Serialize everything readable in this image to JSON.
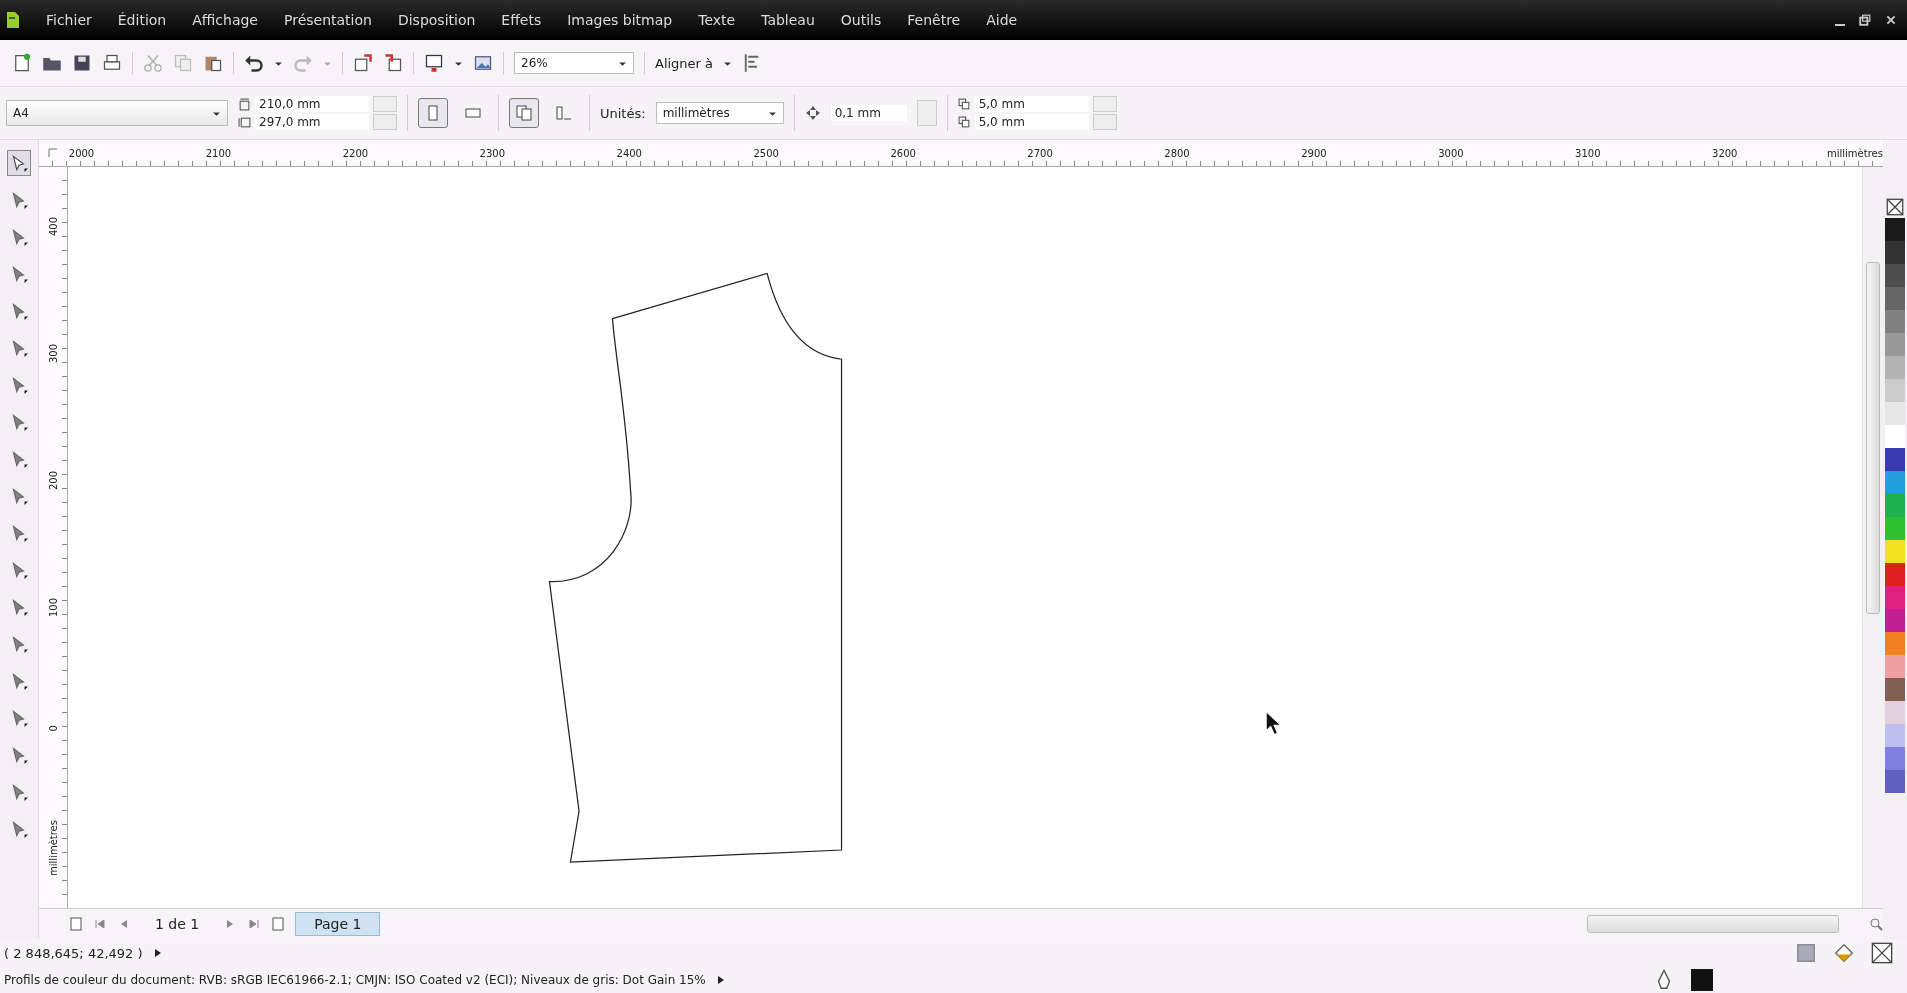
{
  "menu": [
    "Fichier",
    "Édition",
    "Affichage",
    "Présentation",
    "Disposition",
    "Effets",
    "Images bitmap",
    "Texte",
    "Tableau",
    "Outils",
    "Fenêtre",
    "Aide"
  ],
  "toolbar": {
    "zoom": "26%",
    "align": "Aligner à"
  },
  "property_bar": {
    "page_size": "A4",
    "width": "210,0 mm",
    "height": "297,0 mm",
    "units_label": "Unités:",
    "units": "millimètres",
    "nudge": "0,1 mm",
    "dup_x": "5,0 mm",
    "dup_y": "5,0 mm"
  },
  "ruler_h": {
    "ticks": [
      "2000",
      "2100",
      "2200",
      "2300",
      "2400",
      "2500",
      "2600",
      "2700",
      "2800",
      "2900",
      "3000",
      "3100",
      "3200"
    ],
    "unit": "millimètres"
  },
  "ruler_v": {
    "ticks": [
      "400",
      "300",
      "200",
      "100",
      "0"
    ],
    "unit": "millimètres"
  },
  "page_nav": {
    "count": "1 de 1",
    "tabs": [
      {
        "label": "Page 1",
        "selected": true
      }
    ]
  },
  "status": {
    "coords": "( 2 848,645; 42,492 )",
    "color_profiles": "Profils de couleur du document: RVB: sRGB IEC61966-2.1; CMJN: ISO Coated v2 (ECI); Niveaux de gris: Dot Gain 15%"
  },
  "palette": [
    {
      "color": "#1a1a1a"
    },
    {
      "color": "#333333"
    },
    {
      "color": "#4d4d4d"
    },
    {
      "color": "#666666"
    },
    {
      "color": "#808080"
    },
    {
      "color": "#999999"
    },
    {
      "color": "#b3b3b3"
    },
    {
      "color": "#cccccc"
    },
    {
      "color": "#e6e6e6"
    },
    {
      "color": "#ffffff"
    },
    {
      "color": "#3a3ab0"
    },
    {
      "color": "#1fa0d8"
    },
    {
      "color": "#1fb050"
    },
    {
      "color": "#2fc030"
    },
    {
      "color": "#f0e020"
    },
    {
      "color": "#e02020"
    },
    {
      "color": "#e02080"
    },
    {
      "color": "#c02090"
    },
    {
      "color": "#f08020"
    },
    {
      "color": "#f0a0a0"
    },
    {
      "color": "#806050"
    },
    {
      "color": "#e0d0e0"
    },
    {
      "color": "#c0c0f0"
    },
    {
      "color": "#8080e0"
    },
    {
      "color": "#6060c0"
    }
  ]
}
